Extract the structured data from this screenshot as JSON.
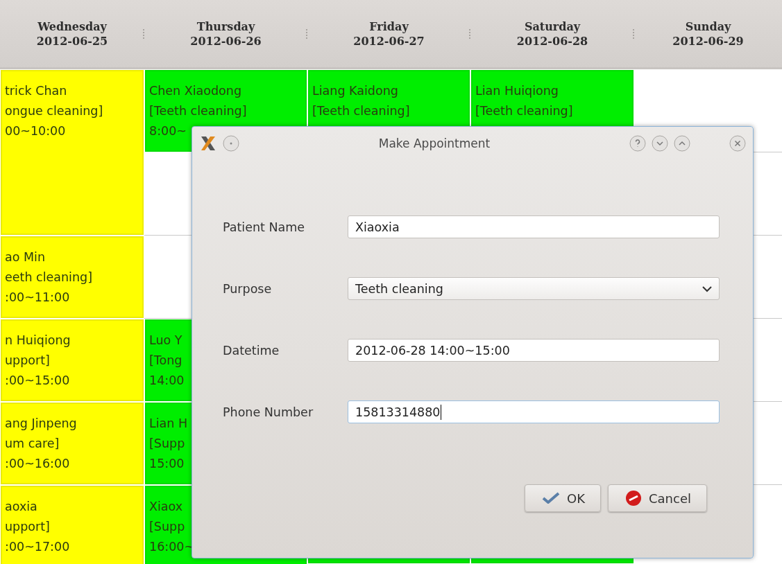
{
  "calendar": {
    "columns": [
      {
        "day": "Wednesday",
        "date": "2012-06-25",
        "cells": [
          {
            "kind": "booked_long",
            "color": "#ffff00",
            "lines": [
              "trick Chan",
              "ongue cleaning]",
              "00~10:00"
            ]
          },
          {
            "kind": "booked",
            "color": "#ffff00",
            "lines": [
              "ao Min",
              "eeth cleaning]",
              ":00~11:00"
            ]
          },
          {
            "kind": "booked",
            "color": "#ffff00",
            "lines": [
              "n Huiqiong",
              "upport]",
              ":00~15:00"
            ]
          },
          {
            "kind": "booked",
            "color": "#ffff00",
            "lines": [
              "ang Jinpeng",
              "um care]",
              ":00~16:00"
            ]
          },
          {
            "kind": "booked",
            "color": "#ffff00",
            "lines": [
              "aoxia",
              "upport]",
              ":00~17:00"
            ]
          }
        ]
      },
      {
        "day": "Thursday",
        "date": "2012-06-26",
        "cells": [
          {
            "kind": "booked",
            "color": "#00ee00",
            "lines": [
              "Chen Xiaodong",
              "[Teeth cleaning]",
              "8:00~"
            ]
          },
          {
            "kind": "empty"
          },
          {
            "kind": "empty"
          },
          {
            "kind": "booked",
            "color": "#00ee00",
            "lines": [
              "Luo Y",
              "[Tong",
              "14:00"
            ]
          },
          {
            "kind": "booked",
            "color": "#00ee00",
            "lines": [
              "Lian H",
              "[Supp",
              "15:00"
            ]
          },
          {
            "kind": "booked",
            "color": "#00ee00",
            "lines": [
              "Xiaox",
              "[Supp",
              "16:00~"
            ]
          }
        ]
      },
      {
        "day": "Friday",
        "date": "2012-06-27",
        "cells": [
          {
            "kind": "booked",
            "color": "#00ee00",
            "lines": [
              "Liang Kaidong",
              "[Teeth cleaning]"
            ]
          },
          {
            "kind": "booked_bottom",
            "color": "#00ee00"
          }
        ]
      },
      {
        "day": "Saturday",
        "date": "2012-06-28",
        "cells": [
          {
            "kind": "booked",
            "color": "#00ee00",
            "lines": [
              "Lian Huiqiong",
              "[Teeth cleaning]"
            ]
          },
          {
            "kind": "booked_bottom",
            "color": "#00ee00"
          }
        ]
      },
      {
        "day": "Sunday",
        "date": "2012-06-29",
        "cells": [
          {
            "kind": "empty"
          },
          {
            "kind": "empty"
          },
          {
            "kind": "empty"
          },
          {
            "kind": "empty"
          },
          {
            "kind": "empty"
          }
        ]
      }
    ]
  },
  "dialog": {
    "title": "Make Appointment",
    "fields": [
      {
        "kind": "text",
        "label": "Patient Name",
        "value": "Xiaoxia",
        "focused": false
      },
      {
        "kind": "combo",
        "label": "Purpose",
        "value": "Teeth cleaning",
        "focused": false
      },
      {
        "kind": "text",
        "label": "Datetime",
        "value": "2012-06-28 14:00~15:00",
        "focused": false
      },
      {
        "kind": "text",
        "label": "Phone Number",
        "value": "15813314880",
        "focused": true
      }
    ],
    "buttons": [
      {
        "kind": "ok",
        "label": "OK"
      },
      {
        "kind": "cancel",
        "label": "Cancel"
      }
    ]
  }
}
